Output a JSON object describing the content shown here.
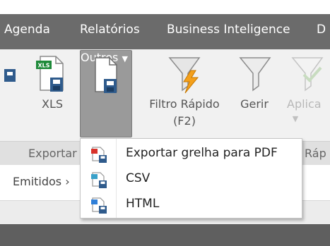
{
  "menubar": {
    "items": [
      "Agenda",
      "Relatórios",
      "Business Inteligence",
      "D"
    ]
  },
  "ribbon": {
    "buttons": {
      "xls": "XLS",
      "outros": "Outros",
      "filtro_rapido_line1": "Filtro Rápido",
      "filtro_rapido_line2": "(F2)",
      "gerir": "Gerir",
      "aplicar": "Aplica"
    },
    "groups": {
      "exportar": "Exportar",
      "rapido": "Ráp"
    }
  },
  "breadcrumb": {
    "text": "Emitidos",
    "separator": "›"
  },
  "dropdown": {
    "items": [
      {
        "label": "Exportar grelha para PDF",
        "icon": "pdf-export-icon"
      },
      {
        "label": "CSV",
        "icon": "csv-export-icon"
      },
      {
        "label": "HTML",
        "icon": "html-export-icon"
      }
    ]
  },
  "colors": {
    "menubar": "#6b6b6b",
    "ribbon": "#f1f1f1",
    "pressed_button": "#9a9a9a",
    "funnel_orange": "#f4a01b",
    "save_blue": "#2f5b8c"
  }
}
